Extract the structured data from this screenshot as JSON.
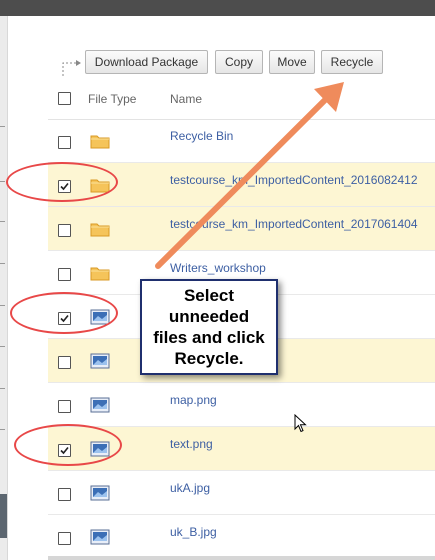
{
  "toolbar": {
    "download_label": "Download Package",
    "copy_label": "Copy",
    "move_label": "Move",
    "recycle_label": "Recycle"
  },
  "table": {
    "headers": {
      "file_type": "File Type",
      "name": "Name"
    },
    "rows": [
      {
        "name": "Recycle Bin",
        "type": "folder-icon",
        "checked": false,
        "highlighted": false
      },
      {
        "name": "testcourse_km_ImportedContent_2016082412",
        "type": "folder-icon",
        "checked": true,
        "highlighted": true
      },
      {
        "name": "testcourse_km_ImportedContent_2017061404",
        "type": "folder-icon",
        "checked": false,
        "highlighted": true
      },
      {
        "name": "Writers_workshop",
        "type": "folder-icon",
        "checked": false,
        "highlighted": false
      },
      {
        "name": "",
        "type": "image-file-icon",
        "checked": true,
        "highlighted": false
      },
      {
        "name": "",
        "type": "image-file-icon",
        "checked": false,
        "highlighted": true
      },
      {
        "name": "map.png",
        "type": "image-file-icon",
        "checked": false,
        "highlighted": false
      },
      {
        "name": "text.png",
        "type": "image-file-icon",
        "checked": true,
        "highlighted": true
      },
      {
        "name": "ukA.jpg",
        "type": "image-file-icon",
        "checked": false,
        "highlighted": false
      },
      {
        "name": "uk_B.jpg",
        "type": "image-file-icon",
        "checked": false,
        "highlighted": false
      }
    ]
  },
  "callout": {
    "line1": "Select",
    "line2": "unneeded",
    "line3": "files and click",
    "line4": "Recycle."
  },
  "colors": {
    "highlight_row": "#fdf6d3",
    "link_text": "#3d5fa3",
    "annotation_red": "#e84848",
    "arrow_orange": "#ef8b5c",
    "callout_border": "#1f2f6e"
  }
}
